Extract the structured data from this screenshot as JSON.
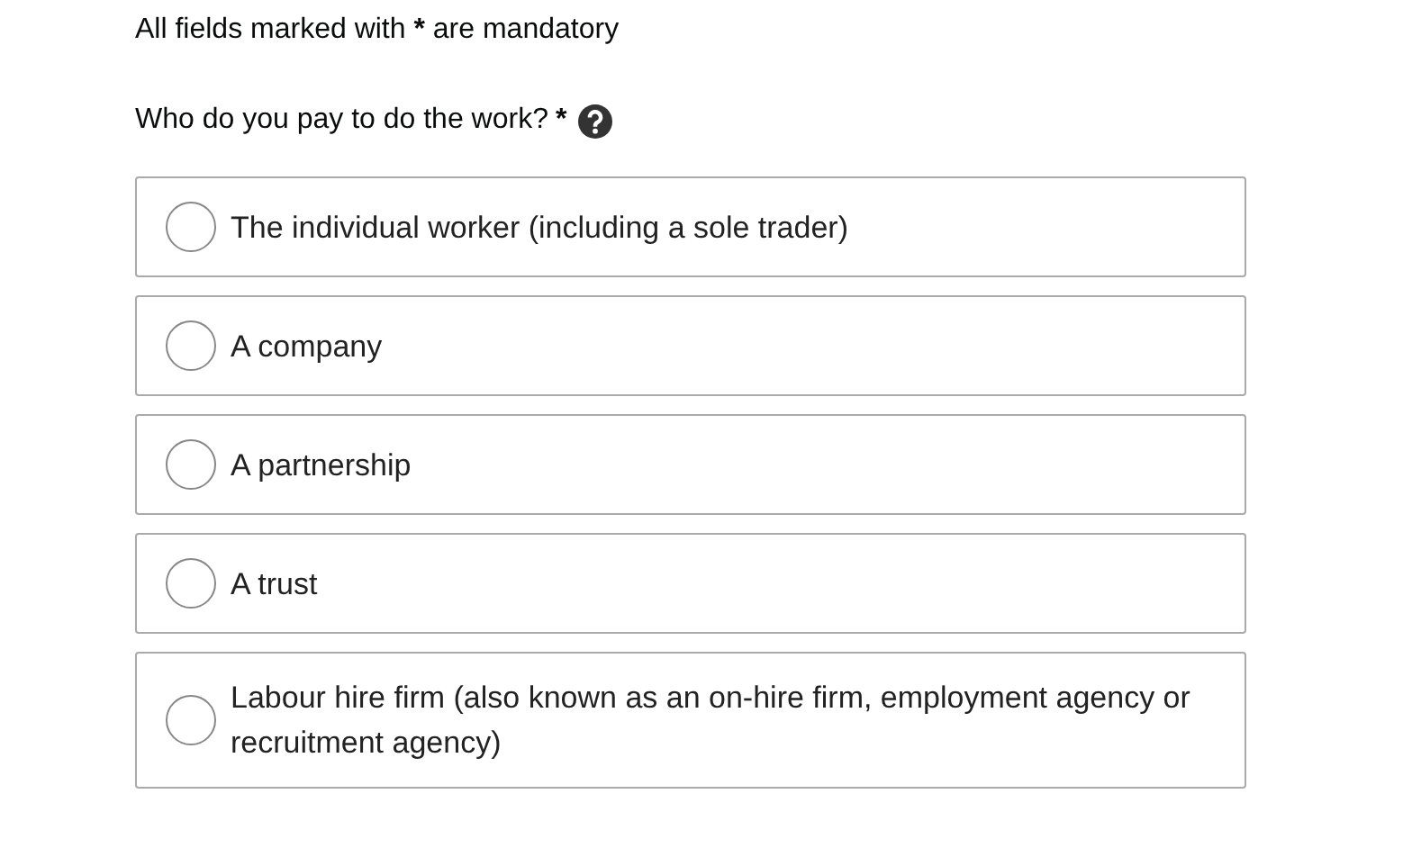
{
  "notice": {
    "text": "All fields marked with",
    "marker": "*",
    "text_after": "are mandatory"
  },
  "question": {
    "label": "Who do you pay to do the work?",
    "required": true,
    "marker": "*",
    "help": true
  },
  "options": [
    {
      "label": "The individual worker (including a sole trader)",
      "selected": false
    },
    {
      "label": "A company",
      "selected": false
    },
    {
      "label": "A partnership",
      "selected": false
    },
    {
      "label": "A trust",
      "selected": false
    },
    {
      "label": "Labour hire firm (also known as an on-hire firm, employment agency or recruitment agency)",
      "selected": false
    }
  ]
}
